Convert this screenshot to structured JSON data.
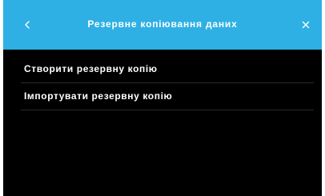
{
  "header": {
    "title": "Резервне копіювання даних",
    "back_icon": "chevron-left-icon",
    "close_icon": "close-icon",
    "background_color": "#2eb0e4"
  },
  "menu": {
    "items": [
      {
        "label": "Створити резервну копію"
      },
      {
        "label": "Імпортувати резервну копію"
      }
    ]
  },
  "colors": {
    "screen_background": "#000000",
    "text": "#ffffff",
    "divider": "#2a2a2a"
  }
}
